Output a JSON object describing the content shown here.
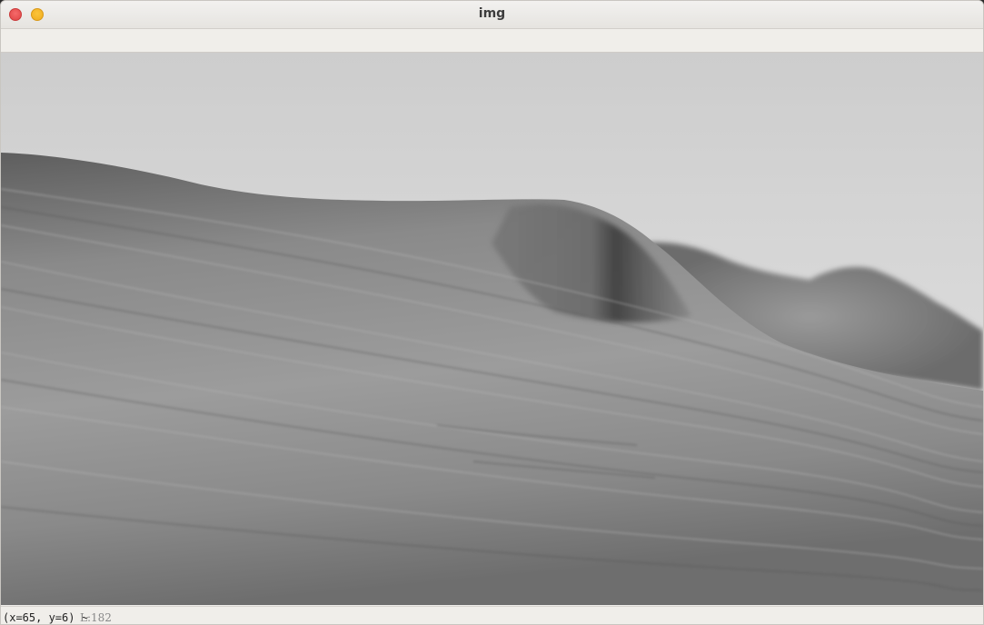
{
  "window": {
    "title": "img"
  },
  "image": {
    "description_icon": "grayscale-wave-photo"
  },
  "status": {
    "coords": "(x=65, y=6) ~",
    "level": "L:182"
  },
  "colors": {
    "close_button": "#e04343",
    "minimize_button": "#f0ac1e",
    "chrome": "#efedea"
  }
}
